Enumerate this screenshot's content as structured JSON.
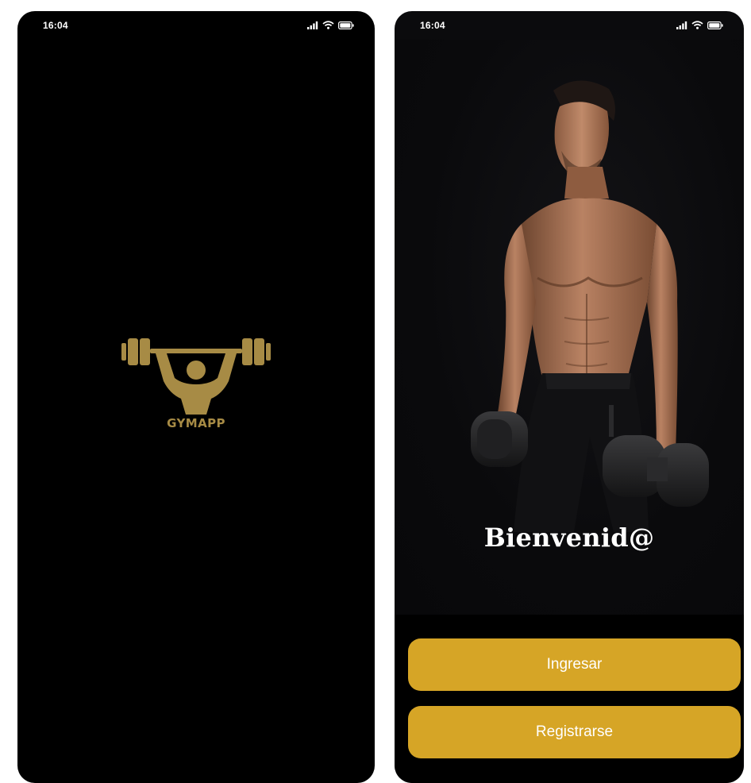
{
  "splash_screen": {
    "status_bar": {
      "time": "16:04",
      "icons": [
        "signal-icon",
        "wifi-icon",
        "battery-icon"
      ]
    },
    "logo": {
      "icon": "weightlifter-logo-icon",
      "text": "GYMAPP",
      "color": "#a78b45"
    },
    "background_color": "#000000"
  },
  "welcome_screen": {
    "status_bar": {
      "time": "16:04",
      "icons": [
        "signal-icon",
        "wifi-icon",
        "battery-icon"
      ]
    },
    "hero_image": "athlete-with-dumbbells-photo",
    "title": "Bienvenid@",
    "buttons": {
      "login_label": "Ingresar",
      "register_label": "Registrarse"
    },
    "accent_color": "#d6a526",
    "background_color": "#0b0b0d"
  }
}
